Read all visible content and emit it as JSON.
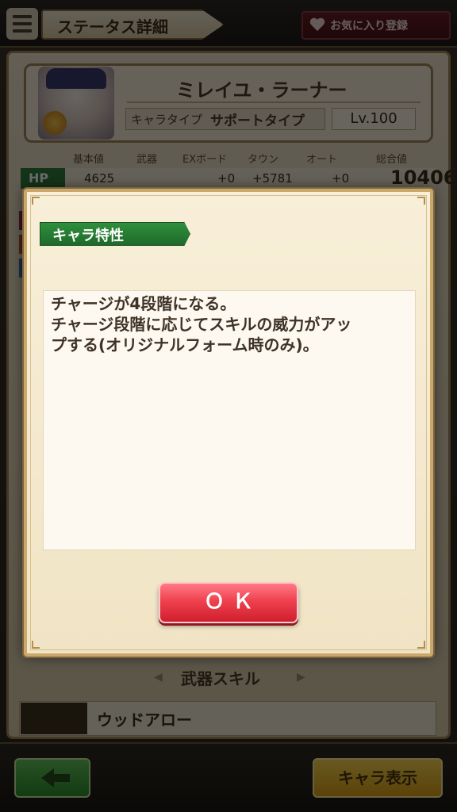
{
  "header": {
    "title": "ステータス詳細",
    "favorite_label": "お気に入り登録"
  },
  "character": {
    "name": "ミレイユ・ラーナー",
    "type_label": "キャラタイプ",
    "type_value": "サポートタイプ",
    "level": "Lv.100"
  },
  "stats": {
    "columns": [
      "基本値",
      "武器",
      "EXボード",
      "タウン",
      "オート",
      "総合値"
    ],
    "rows": [
      {
        "label": "HP",
        "base": "4625",
        "weapon": "",
        "ex_board": "+0",
        "town": "+5781",
        "auto": "+0",
        "total": "10406"
      }
    ]
  },
  "weapon_skill": {
    "title": "武器スキル",
    "name": "ウッドアロー"
  },
  "footer": {
    "chara_view_label": "キャラ表示"
  },
  "modal": {
    "section_label": "キャラ特性",
    "description": "チャージが4段階になる。\nチャージ段階に応じてスキルの威力がアッ\nプする(オリジナルフォーム時のみ)。",
    "ok_label": "ＯＫ"
  },
  "colors": {
    "hp_label_bg": "#2e7d3a",
    "section_tag_bg": "#2f8f3c",
    "ok_button": "#f0414f",
    "modal_bg": "#f8efd9",
    "back_button": "#2d8d2c",
    "chara_button": "#d99e15"
  },
  "icons": [
    "menu-icon",
    "heart-icon",
    "back-arrow-icon"
  ]
}
